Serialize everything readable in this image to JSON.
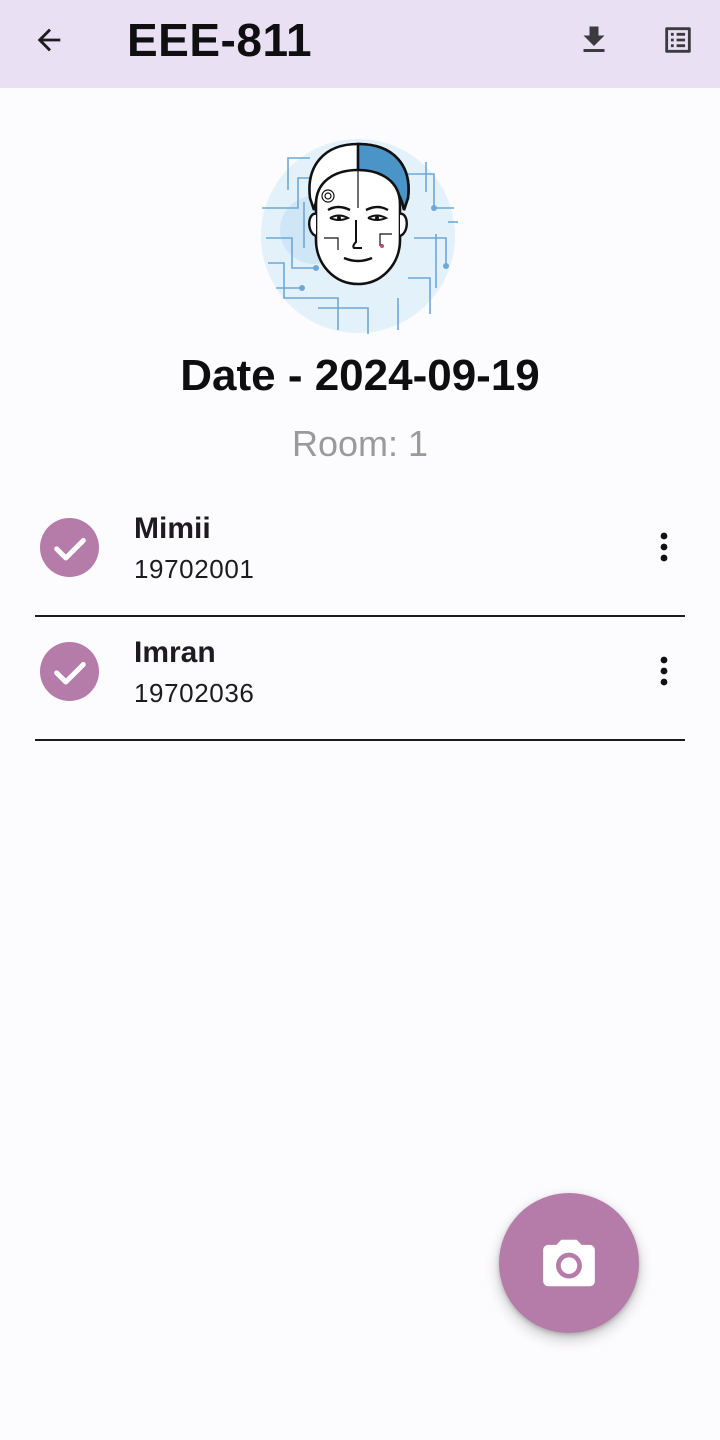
{
  "app_bar": {
    "title": "EEE-811",
    "back_icon": "arrow-back-icon",
    "download_icon": "download-icon",
    "sheet_icon": "list-alt-icon"
  },
  "header": {
    "date_title": "Date - 2024-09-19",
    "room_label": "Room: 1"
  },
  "attendance": [
    {
      "name": "Mimii",
      "id": "19702001",
      "status": "present"
    },
    {
      "name": "Imran",
      "id": "19702036",
      "status": "present"
    }
  ],
  "fab": {
    "icon": "camera-icon"
  },
  "colors": {
    "app_bar_bg": "#e9e0f3",
    "accent": "#b57ca9",
    "background": "#fcfbfd",
    "muted_text": "#9a9a9a"
  }
}
